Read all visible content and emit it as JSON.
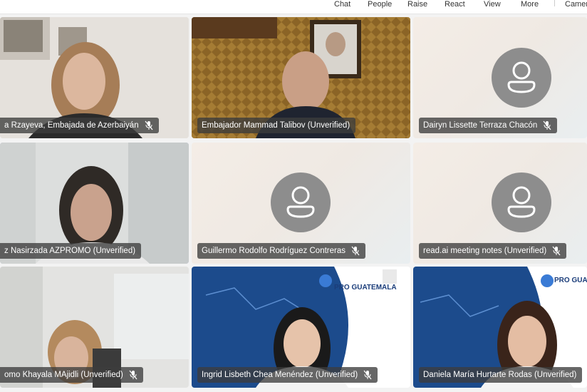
{
  "toolbar": {
    "items": [
      "Chat",
      "People",
      "Raise",
      "React",
      "View",
      "More",
      "Camer"
    ]
  },
  "tiles": [
    {
      "name": "a Rzayeva, Embajada de Azerbaiyán"
    },
    {
      "name": "Embajador Mammad Talibov (Unverified)"
    },
    {
      "name": "Dairyn Lissette Terraza Chacón"
    },
    {
      "name": "z Nasirzada AZPROMO (Unverified)"
    },
    {
      "name": "Guillermo Rodolfo Rodríguez Contreras"
    },
    {
      "name": "read.ai meeting notes (Unverified)"
    },
    {
      "name": "omo Khayala MAjidli (Unverified)"
    },
    {
      "name": "Ingrid Lisbeth Chea Menéndez (Unverified)"
    },
    {
      "name": "Daniela María Hurtarte Rodas (Unverified)"
    }
  ],
  "branding": {
    "logo_text": "PRO GUATEMALA"
  },
  "colors": {
    "selected_outline": "#8a8bd0",
    "avatar": "#8d8d8d",
    "name_tag_bg": "rgba(60,60,60,0.78)"
  }
}
